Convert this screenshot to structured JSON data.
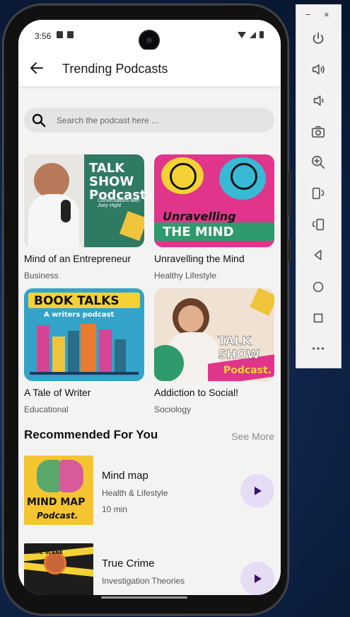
{
  "status": {
    "time": "3:56"
  },
  "appbar": {
    "title": "Trending Podcasts"
  },
  "search": {
    "placeholder": "Search the podcast here ..."
  },
  "trending": [
    {
      "title": "Mind of an Entrepreneur",
      "category": "Business",
      "art_title": "TALK SHOW Podcast.",
      "art_sub": "Conversations with Joey Hight"
    },
    {
      "title": "Unravelling the Mind",
      "category": "Healthy Lifestyle",
      "art_title": "Unravelling",
      "art_title2": "THE MIND"
    },
    {
      "title": "A Tale of Writer",
      "category": "Educational",
      "art_title": "BOOK TALKS",
      "art_sub": "A writers podcast"
    },
    {
      "title": "Addiction to Social!",
      "category": "Sociology",
      "art_title": "TALK SHOW",
      "art_sub": "Podcast."
    }
  ],
  "recommended": {
    "heading": "Recommended For You",
    "see_more": "See More",
    "items": [
      {
        "title": "Mind map",
        "category": "Health & Lifestyle",
        "duration": "10 min",
        "art_title": "MIND MAP",
        "art_sub": "Podcast."
      },
      {
        "title": "True Crime",
        "category": "Investigation Theories",
        "duration": "",
        "art_title": "CRIME SCENE"
      }
    ]
  },
  "emulator_toolbar": {
    "minimize": "−",
    "close": "×",
    "icons": [
      "power-icon",
      "volume-up-icon",
      "volume-down-icon",
      "camera-icon",
      "zoom-in-icon",
      "rotate-left-icon",
      "rotate-right-icon",
      "back-icon",
      "home-icon",
      "overview-icon",
      "more-icon"
    ]
  },
  "colors": {
    "accent": "#3b1466",
    "play_bg": "#e6dcf4",
    "background": "#f3f3f3"
  }
}
